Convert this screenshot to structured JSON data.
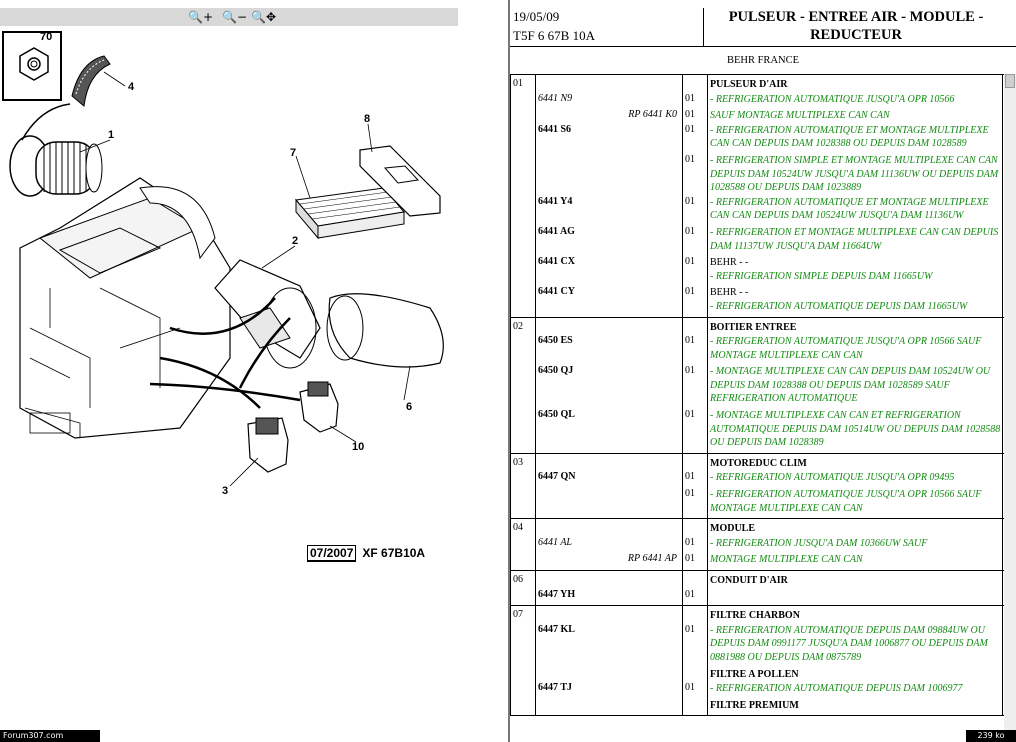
{
  "toolbar": {
    "zoom_in": "🔍+",
    "zoom_out": "🔍−",
    "zoom_pan": "🔍✥",
    "zoom_in_icon": "magnifier-plus-icon",
    "zoom_out_icon": "magnifier-minus-icon",
    "pan_icon": "magnifier-move-icon"
  },
  "diagram": {
    "callouts": [
      "70",
      "4",
      "1",
      "8",
      "7",
      "2",
      "6",
      "10",
      "3"
    ],
    "stamp_date": "07/2007",
    "stamp_code": "XF 67B10A"
  },
  "footer": {
    "site": "Forum307.com",
    "size": "239 ko"
  },
  "header": {
    "date": "19/05/09",
    "code": "T5F 6 67B 10A",
    "title": "PULSEUR - ENTREE AIR - MODULE - REDUCTEUR",
    "maker": "BEHR FRANCE"
  },
  "colors": {
    "note_green": "#118a11",
    "toolbar": "#d8d8d8"
  },
  "groups": [
    {
      "num": "01",
      "rows": [
        {
          "ref": "",
          "qty": "",
          "label": "PULSEUR D'AIR",
          "notes": []
        },
        {
          "ref": "6441 N9",
          "ref_italic": true,
          "qty": "01",
          "label": "",
          "notes": [
            "- REFRIGERATION AUTOMATIQUE JUSQU'A OPR 10566"
          ]
        },
        {
          "ref": "",
          "rp": "RP 6441 K0",
          "qty": "01",
          "label": "",
          "notes": [
            "SAUF MONTAGE MULTIPLEXE CAN CAN"
          ]
        },
        {
          "ref": "6441 S6",
          "qty": "01",
          "label": "",
          "notes": [
            "- REFRIGERATION AUTOMATIQUE ET MONTAGE MULTIPLEXE CAN CAN DEPUIS DAM 1028388 OU DEPUIS DAM 1028589"
          ]
        },
        {
          "ref": "",
          "qty": "01",
          "label": "",
          "notes": [
            "- REFRIGERATION SIMPLE ET MONTAGE MULTIPLEXE CAN CAN DEPUIS DAM 10524UW JUSQU'A DAM 11136UW OU DEPUIS DAM 1028588 OU DEPUIS DAM 1023889"
          ]
        },
        {
          "ref": "6441 Y4",
          "qty": "01",
          "label": "",
          "notes": [
            "- REFRIGERATION AUTOMATIQUE ET MONTAGE MULTIPLEXE CAN CAN DEPUIS DAM 10524UW JUSQU'A DAM 11136UW"
          ]
        },
        {
          "ref": "6441 AG",
          "qty": "01",
          "label": "",
          "notes": [
            "- REFRIGERATION ET MONTAGE MULTIPLEXE CAN CAN DEPUIS DAM 11137UW JUSQU'A DAM 11664UW"
          ]
        },
        {
          "ref": "6441 CX",
          "qty": "01",
          "label": "BEHR - -",
          "label_plain": true,
          "notes": [
            "- REFRIGERATION SIMPLE DEPUIS DAM 11665UW"
          ]
        },
        {
          "ref": "6441 CY",
          "qty": "01",
          "label": "BEHR - -",
          "label_plain": true,
          "notes": [
            "- REFRIGERATION AUTOMATIQUE DEPUIS DAM 11665UW"
          ]
        }
      ]
    },
    {
      "num": "02",
      "rows": [
        {
          "ref": "",
          "qty": "",
          "label": "BOITIER ENTREE",
          "notes": []
        },
        {
          "ref": "6450 ES",
          "qty": "01",
          "label": "",
          "notes": [
            "- REFRIGERATION AUTOMATIQUE JUSQU'A OPR 10566 SAUF MONTAGE MULTIPLEXE CAN CAN"
          ]
        },
        {
          "ref": "6450 QJ",
          "qty": "01",
          "label": "",
          "notes": [
            "- MONTAGE MULTIPLEXE CAN CAN DEPUIS DAM 10524UW OU DEPUIS DAM 1028388 OU DEPUIS DAM 1028589 SAUF REFRIGERATION AUTOMATIQUE"
          ]
        },
        {
          "ref": "6450 QL",
          "qty": "01",
          "label": "",
          "notes": [
            "- MONTAGE MULTIPLEXE CAN CAN ET REFRIGERATION AUTOMATIQUE DEPUIS DAM 10514UW OU DEPUIS DAM 1028588 OU DEPUIS DAM 1028389"
          ]
        }
      ]
    },
    {
      "num": "03",
      "rows": [
        {
          "ref": "",
          "qty": "",
          "label": "MOTOREDUC CLIM",
          "notes": []
        },
        {
          "ref": "6447 QN",
          "qty": "01",
          "label": "",
          "notes": [
            "- REFRIGERATION AUTOMATIQUE JUSQU'A OPR 09495"
          ]
        },
        {
          "ref": "",
          "qty": "01",
          "label": "",
          "notes": [
            "- REFRIGERATION AUTOMATIQUE JUSQU'A OPR 10566 SAUF MONTAGE MULTIPLEXE CAN CAN"
          ]
        }
      ]
    },
    {
      "num": "04",
      "rows": [
        {
          "ref": "",
          "qty": "",
          "label": "MODULE",
          "notes": []
        },
        {
          "ref": "6441 AL",
          "ref_italic": true,
          "qty": "01",
          "label": "",
          "notes": [
            "- REFRIGERATION JUSQU'A DAM 10366UW SAUF"
          ]
        },
        {
          "ref": "",
          "rp": "RP 6441 AP",
          "qty": "01",
          "label": "",
          "notes": [
            "MONTAGE MULTIPLEXE CAN CAN"
          ]
        }
      ]
    },
    {
      "num": "06",
      "rows": [
        {
          "ref": "",
          "qty": "",
          "label": "CONDUIT D'AIR",
          "notes": []
        },
        {
          "ref": "6447 YH",
          "qty": "01",
          "label": "",
          "notes": [
            ""
          ]
        }
      ]
    },
    {
      "num": "07",
      "rows": [
        {
          "ref": "",
          "qty": "",
          "label": "FILTRE CHARBON",
          "notes": []
        },
        {
          "ref": "6447 KL",
          "qty": "01",
          "label": "",
          "notes": [
            "- REFRIGERATION AUTOMATIQUE DEPUIS DAM 09884UW OU DEPUIS DAM 0991177 JUSQU'A DAM 1006877 OU DEPUIS DAM 0881988 OU DEPUIS DAM 0875789"
          ]
        },
        {
          "ref": "",
          "qty": "",
          "label": "FILTRE A POLLEN",
          "notes": []
        },
        {
          "ref": "6447 TJ",
          "qty": "01",
          "label": "",
          "notes": [
            "- REFRIGERATION AUTOMATIQUE DEPUIS DAM 1006977"
          ]
        },
        {
          "ref": "",
          "qty": "",
          "label": "FILTRE PREMIUM",
          "notes": []
        }
      ]
    }
  ]
}
